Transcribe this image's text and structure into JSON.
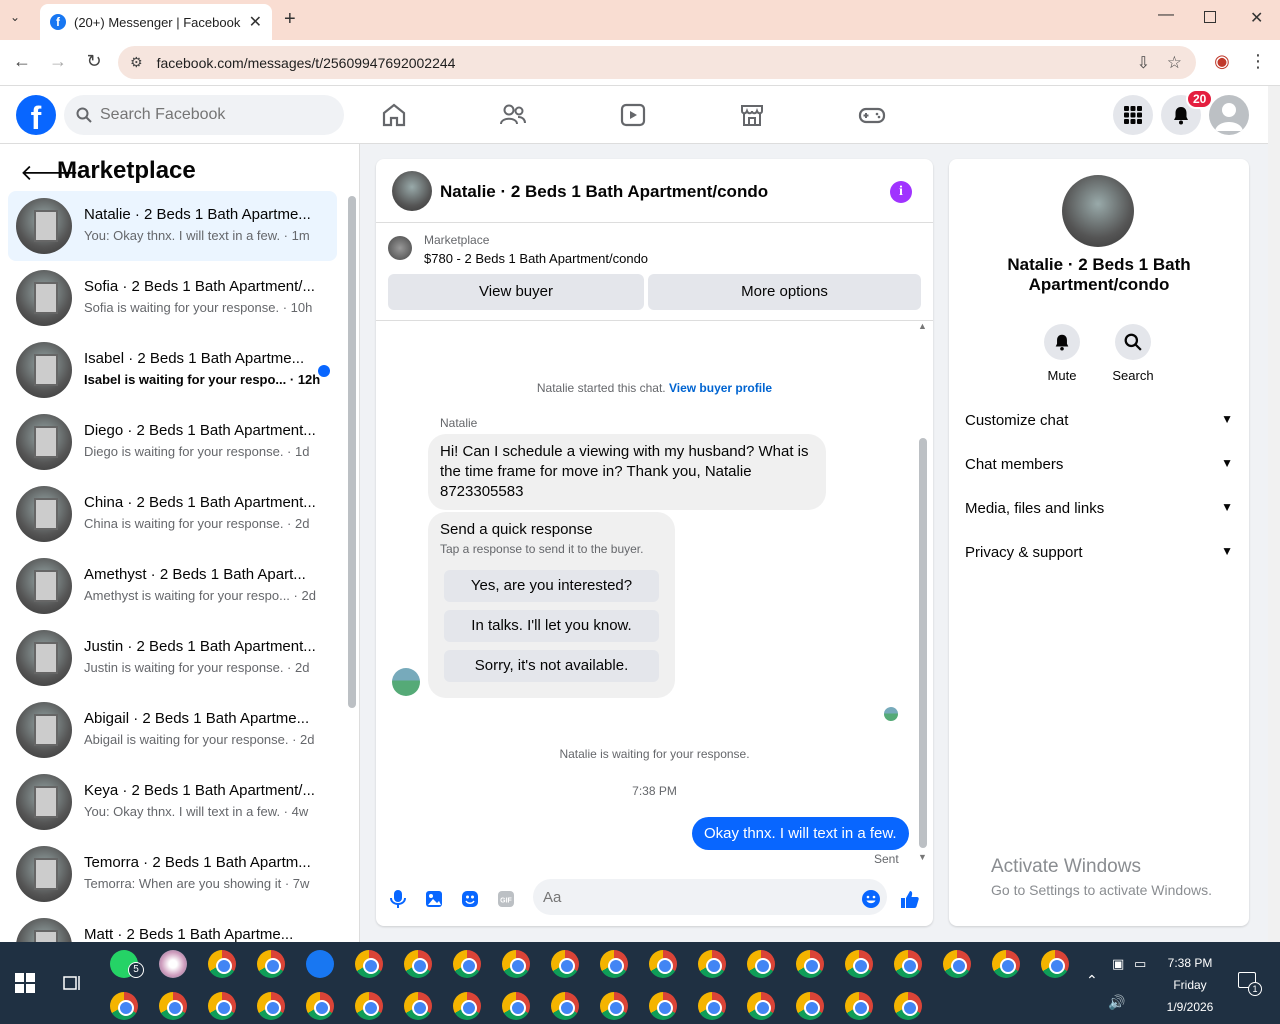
{
  "browser": {
    "tab_title": "(20+) Messenger | Facebook",
    "url": "facebook.com/messages/t/25609947692002244"
  },
  "fb_header": {
    "search_placeholder": "Search Facebook",
    "notification_count": "20"
  },
  "left_panel": {
    "title": "Marketplace",
    "conversations": [
      {
        "name": "Natalie · 2 Beds 1 Bath Apartme...",
        "preview": "You: Okay thnx. I will text in a few. · 1m",
        "active": true,
        "unread": false
      },
      {
        "name": "Sofia · 2 Beds 1 Bath Apartment/...",
        "preview": "Sofia is waiting for your response. · 10h",
        "active": false,
        "unread": false
      },
      {
        "name": "Isabel · 2 Beds 1 Bath Apartme...",
        "preview": "Isabel is waiting for your respo... · 12h",
        "active": false,
        "unread": true
      },
      {
        "name": "Diego · 2 Beds 1 Bath Apartment...",
        "preview": "Diego is waiting for your response. · 1d",
        "active": false,
        "unread": false
      },
      {
        "name": "China · 2 Beds 1 Bath Apartment...",
        "preview": "China is waiting for your response. · 2d",
        "active": false,
        "unread": false
      },
      {
        "name": "Amethyst · 2 Beds 1 Bath Apart...",
        "preview": "Amethyst is waiting for your respo... · 2d",
        "active": false,
        "unread": false
      },
      {
        "name": "Justin · 2 Beds 1 Bath Apartment...",
        "preview": "Justin is waiting for your response. · 2d",
        "active": false,
        "unread": false
      },
      {
        "name": "Abigail · 2 Beds 1 Bath Apartme...",
        "preview": "Abigail is waiting for your response. · 2d",
        "active": false,
        "unread": false
      },
      {
        "name": "Keya · 2 Beds 1 Bath Apartment/...",
        "preview": "You: Okay thnx. I will text in a few. · 4w",
        "active": false,
        "unread": false
      },
      {
        "name": "Temorra · 2 Beds 1 Bath Apartm...",
        "preview": "Temorra: When are you showing it · 7w",
        "active": false,
        "unread": false
      },
      {
        "name": "Matt · 2 Beds 1 Bath Apartme...",
        "preview": "",
        "active": false,
        "unread": false
      }
    ]
  },
  "chat": {
    "title": "Natalie · 2 Beds 1 Bath Apartment/condo",
    "marketplace_label": "Marketplace",
    "listing": "$780 - 2 Beds 1 Bath Apartment/condo",
    "view_buyer": "View buyer",
    "more_options": "More options",
    "started_text": "Natalie started this chat.",
    "view_profile_link": "View buyer profile",
    "sender_name": "Natalie",
    "incoming_message": "Hi! Can I schedule a viewing with my husband? What is the time frame for move in? Thank you, Natalie 8723305583",
    "quick_title": "Send a quick response",
    "quick_subtitle": "Tap a response to send it to the buyer.",
    "quick_responses": [
      "Yes, are you interested?",
      "In talks. I'll let you know.",
      "Sorry, it's not available."
    ],
    "waiting_text": "Natalie is waiting for your response.",
    "timestamp": "7:38 PM",
    "outgoing_message": "Okay thnx. I will text in a few.",
    "sent_label": "Sent",
    "input_placeholder": "Aa"
  },
  "right_panel": {
    "name": "Natalie · 2 Beds 1 Bath Apartment/condo",
    "mute_label": "Mute",
    "search_label": "Search",
    "sections": [
      "Customize chat",
      "Chat members",
      "Media, files and links",
      "Privacy & support"
    ]
  },
  "watermark": {
    "line1": "Activate Windows",
    "line2": "Go to Settings to activate Windows."
  },
  "taskbar": {
    "time": "7:38 PM",
    "day": "Friday",
    "date": "1/9/2026",
    "whatsapp_badge": "5",
    "notif_badge": "1"
  }
}
